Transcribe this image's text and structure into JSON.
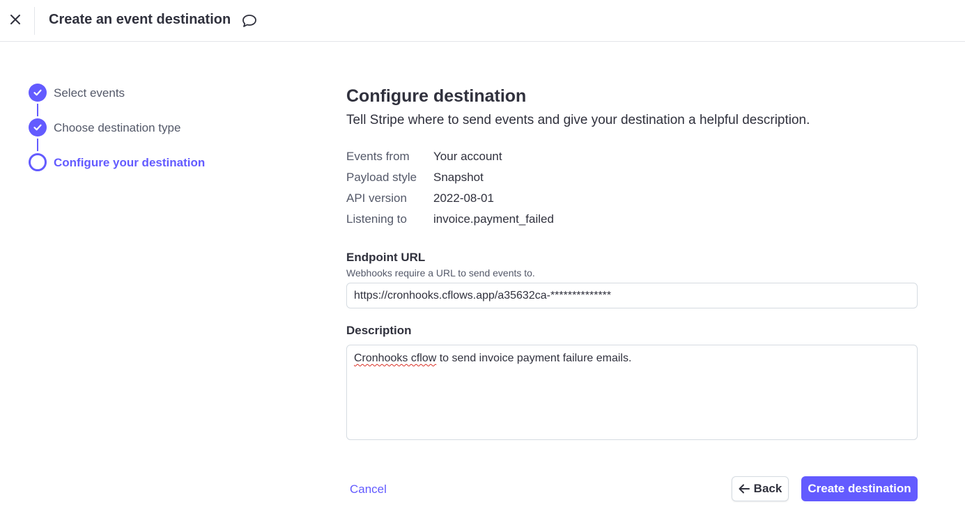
{
  "header": {
    "title": "Create an event destination",
    "close_icon": "close-icon",
    "feedback_icon": "speech-bubble-icon"
  },
  "stepper": {
    "steps": [
      {
        "label": "Select events",
        "state": "done"
      },
      {
        "label": "Choose destination type",
        "state": "done"
      },
      {
        "label": "Configure your destination",
        "state": "current"
      }
    ]
  },
  "main": {
    "title": "Configure destination",
    "subtitle": "Tell Stripe where to send events and give your destination a helpful description.",
    "details": [
      {
        "key": "Events from",
        "value": "Your account"
      },
      {
        "key": "Payload style",
        "value": "Snapshot"
      },
      {
        "key": "API version",
        "value": "2022-08-01"
      },
      {
        "key": "Listening to",
        "value": "invoice.payment_failed"
      }
    ],
    "endpoint": {
      "label": "Endpoint URL",
      "help": "Webhooks require a URL to send events to.",
      "value": "https://cronhooks.cflows.app/a35632ca-**************"
    },
    "description": {
      "label": "Description",
      "value_part1": "Cronhooks cflow",
      "value_part2": " to send invoice payment failure emails."
    }
  },
  "footer": {
    "cancel_label": "Cancel",
    "back_label": "Back",
    "create_label": "Create destination"
  },
  "colors": {
    "accent": "#635bff",
    "text": "#30313d",
    "muted": "#545969",
    "border": "#d5dbe1"
  }
}
